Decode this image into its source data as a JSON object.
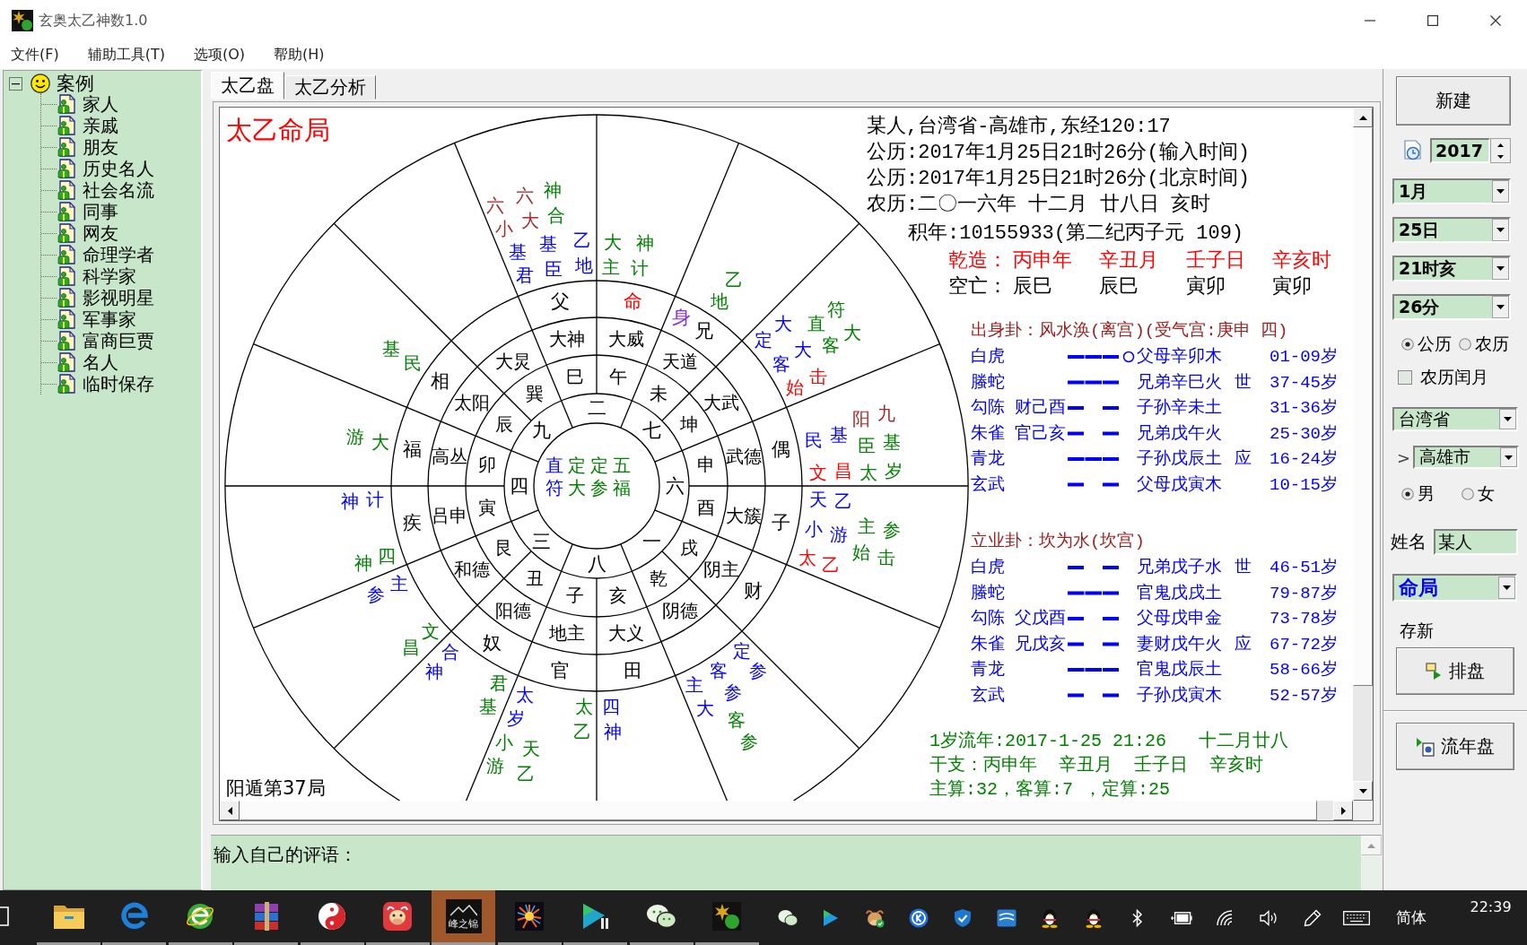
{
  "window": {
    "title": "玄奥太乙神数1.0"
  },
  "menu": [
    "文件(F)",
    "辅助工具(T)",
    "选项(O)",
    "帮助(H)"
  ],
  "tree": {
    "label": "案例",
    "expanded": true,
    "children": [
      {
        "label": "家人",
        "selected": false
      },
      {
        "label": "亲戚",
        "selected": false
      },
      {
        "label": "朋友",
        "selected": false
      },
      {
        "label": "历史名人",
        "selected": false
      },
      {
        "label": "社会名流",
        "selected": false
      },
      {
        "label": "同事",
        "selected": false
      },
      {
        "label": "网友",
        "selected": false
      },
      {
        "label": "命理学者",
        "selected": false
      },
      {
        "label": "科学家",
        "selected": false
      },
      {
        "label": "影视明星",
        "selected": false
      },
      {
        "label": "军事家",
        "selected": false
      },
      {
        "label": "富商巨贾",
        "selected": false
      },
      {
        "label": "名人",
        "selected": false
      },
      {
        "label": "临时保存",
        "selected": false
      }
    ]
  },
  "tabs": [
    {
      "label": "太乙盘",
      "selected": true
    },
    {
      "label": "太乙分析",
      "selected": false
    }
  ],
  "chart": {
    "title": "太乙命局",
    "footer": "阳遁第37局",
    "center": [
      {
        "text": "直符",
        "color": "#0000ff"
      },
      {
        "text": "定大",
        "color": "#008000"
      },
      {
        "text": "定参",
        "color": "#008000"
      },
      {
        "text": "五福",
        "color": "#008000"
      }
    ],
    "numbers": [
      "二",
      "九",
      "七",
      "四",
      "六",
      "三",
      "一",
      "八"
    ],
    "sectors": [
      {
        "branch": "巳",
        "god": "大神",
        "palaces": [
          {
            "text": "父",
            "color": "#000000"
          }
        ],
        "stars": [
          {
            "text": "六小",
            "color": "#a52a2a"
          },
          {
            "text": "六大",
            "color": "#a52a2a"
          },
          {
            "text": "神合",
            "color": "#008000"
          },
          {
            "text": "基君",
            "color": "#0000ff"
          },
          {
            "text": "基臣",
            "color": "#0000ff"
          },
          {
            "text": "乙地",
            "color": "#0000ff"
          }
        ]
      },
      {
        "branch": "午",
        "god": "大威",
        "palaces": [
          {
            "text": "命",
            "color": "#ff0000"
          }
        ],
        "stars": [
          {
            "text": "大主",
            "color": "#008000"
          },
          {
            "text": "神计",
            "color": "#008000"
          }
        ]
      },
      {
        "branch": "巽",
        "god": "大炅"
      },
      {
        "branch": "未",
        "god": "天道",
        "palaces": [
          {
            "text": "身",
            "color": "#8a2be2"
          },
          {
            "text": "兄",
            "color": "#000000"
          }
        ],
        "stars": [
          {
            "text": "乙地",
            "color": "#008000"
          }
        ]
      },
      {
        "branch": "辰",
        "god": "太阳",
        "palaces": [
          {
            "text": "相",
            "color": "#000000"
          }
        ],
        "stars": [
          {
            "text": "基民",
            "color": "#008000"
          }
        ]
      },
      {
        "branch": "坤",
        "god": "大武",
        "stars": [
          {
            "text": "大定",
            "color": "#0000ff"
          },
          {
            "text": "大客",
            "color": "#0000ff"
          },
          {
            "text": "符直",
            "color": "#008000"
          },
          {
            "text": "大客",
            "color": "#008000"
          },
          {
            "text": "始击",
            "color": "#ff0000"
          }
        ]
      },
      {
        "branch": "卯",
        "god": "高丛",
        "palaces": [
          {
            "text": "福",
            "color": "#000000"
          }
        ],
        "stars": [
          {
            "text": "游大",
            "color": "#008000"
          }
        ]
      },
      {
        "branch": "申",
        "god": "武德",
        "palaces": [
          {
            "text": "偶",
            "color": "#000000"
          }
        ],
        "stars": [
          {
            "text": "阳九",
            "color": "#a52a2a"
          },
          {
            "text": "民基",
            "color": "#0000ff"
          },
          {
            "text": "臣基",
            "color": "#008000"
          },
          {
            "text": "文昌",
            "color": "#ff0000"
          },
          {
            "text": "太岁",
            "color": "#008000"
          }
        ]
      },
      {
        "branch": "寅",
        "god": "吕申",
        "palaces": [
          {
            "text": "疾",
            "color": "#000000"
          }
        ],
        "stars": [
          {
            "text": "神计",
            "color": "#0000ff"
          },
          {
            "text": "神四",
            "color": "#008000"
          }
        ]
      },
      {
        "branch": "酉",
        "god": "大簇",
        "palaces": [
          {
            "text": "子",
            "color": "#000000"
          }
        ],
        "stars": [
          {
            "text": "天乙",
            "color": "#0000ff"
          },
          {
            "text": "小游",
            "color": "#0000ff"
          },
          {
            "text": "主参",
            "color": "#008000"
          },
          {
            "text": "太乙",
            "color": "#ff0000"
          },
          {
            "text": "始击",
            "color": "#008000"
          }
        ]
      },
      {
        "branch": "艮",
        "god": "和德",
        "stars": [
          {
            "text": "参主",
            "color": "#0000ff"
          },
          {
            "text": "文昌",
            "color": "#008000"
          }
        ]
      },
      {
        "branch": "戌",
        "god": "阴主",
        "palaces": [
          {
            "text": "财",
            "color": "#000000"
          }
        ]
      },
      {
        "branch": "丑",
        "god": "阳德",
        "palaces": [
          {
            "text": "奴",
            "color": "#000000"
          }
        ],
        "stars": [
          {
            "text": "合神",
            "color": "#0000ff"
          },
          {
            "text": "君基",
            "color": "#008000"
          }
        ]
      },
      {
        "branch": "乾",
        "god": "阴德",
        "stars": [
          {
            "text": "定参",
            "color": "#0000ff"
          },
          {
            "text": "客参",
            "color": "#0000ff"
          },
          {
            "text": "主大",
            "color": "#0000ff"
          },
          {
            "text": "客参",
            "color": "#008000"
          }
        ]
      },
      {
        "branch": "子",
        "god": "地主",
        "palaces": [
          {
            "text": "官",
            "color": "#000000"
          }
        ],
        "stars": [
          {
            "text": "太岁",
            "color": "#0000ff"
          },
          {
            "text": "太乙",
            "color": "#008000"
          },
          {
            "text": "小游",
            "color": "#008000"
          },
          {
            "text": "天乙",
            "color": "#008000"
          }
        ]
      },
      {
        "branch": "亥",
        "god": "大义",
        "palaces": [
          {
            "text": "田",
            "color": "#000000"
          }
        ],
        "stars": [
          {
            "text": "四神",
            "color": "#0000ff"
          }
        ]
      }
    ]
  },
  "info": {
    "lines": [
      "某人,台湾省-高雄市,东经120:17",
      "公历:2017年1月25日21时26分(输入时间)",
      "公历:2017年1月25日21时26分(北京时间)",
      "农历:二〇一六年 十二月 廿八日 亥时"
    ],
    "accumulated": "积年:10155933(第二纪丙子元 109)",
    "pillars": {
      "label": "乾造：",
      "values": [
        "丙申年",
        "辛丑月",
        "壬子日",
        "辛亥时"
      ]
    },
    "void": {
      "label": "空亡：",
      "values": [
        "辰巳",
        "辰巳",
        "寅卯",
        "寅卯"
      ]
    }
  },
  "gua": [
    {
      "title": "出身卦：风水涣(离宫)(受气宫:庚申 四)",
      "lines": [
        {
          "god": "白虎",
          "kind": "yang",
          "moving": true,
          "relation": "父母辛卯木",
          "age": "01-09岁"
        },
        {
          "god": "螣蛇",
          "kind": "yang",
          "moving": false,
          "relation": "兄弟辛巳火",
          "mark": "世",
          "age": "37-45岁"
        },
        {
          "god": "勾陈",
          "hidden": "财己酉",
          "kind": "yin",
          "moving": false,
          "relation": "子孙辛未土",
          "age": "31-36岁"
        },
        {
          "god": "朱雀",
          "hidden": "官己亥",
          "kind": "yin",
          "moving": false,
          "relation": "兄弟戊午火",
          "age": "25-30岁"
        },
        {
          "god": "青龙",
          "kind": "yang",
          "moving": false,
          "relation": "子孙戊辰土",
          "mark": "应",
          "age": "16-24岁"
        },
        {
          "god": "玄武",
          "kind": "yin",
          "moving": false,
          "relation": "父母戊寅木",
          "age": "10-15岁"
        }
      ]
    },
    {
      "title": "立业卦：坎为水(坎宫)",
      "lines": [
        {
          "god": "白虎",
          "kind": "yin",
          "moving": false,
          "relation": "兄弟戊子水",
          "mark": "世",
          "age": "46-51岁"
        },
        {
          "god": "螣蛇",
          "kind": "yang",
          "moving": false,
          "relation": "官鬼戊戌土",
          "age": "79-87岁"
        },
        {
          "god": "勾陈",
          "hidden": "父戊酉",
          "kind": "yin",
          "moving": false,
          "relation": "父母戊申金",
          "age": "73-78岁"
        },
        {
          "god": "朱雀",
          "hidden": "兄戊亥",
          "kind": "yin",
          "moving": false,
          "relation": "妻财戊午火",
          "mark": "应",
          "age": "67-72岁"
        },
        {
          "god": "青龙",
          "kind": "yang",
          "moving": false,
          "relation": "官鬼戊辰土",
          "age": "58-66岁"
        },
        {
          "god": "玄武",
          "kind": "yin",
          "moving": false,
          "relation": "子孙戊寅木",
          "age": "52-57岁"
        }
      ]
    }
  ],
  "annual": [
    "1岁流年:2017-1-25 21:26   十二月廿八",
    "干支：丙申年  辛丑月  壬子日  辛亥时",
    "主算:32，客算:7 ，定算:25"
  ],
  "comment": {
    "value": "输入自己的评语："
  },
  "controls": {
    "new_button": "新建",
    "year": "2017",
    "month": "1月",
    "day": "25日",
    "hour": "21时亥",
    "minute": "26分",
    "calendar": [
      {
        "label": "公历",
        "selected": true
      },
      {
        "label": "农历",
        "selected": false
      }
    ],
    "leap_month": {
      "label": "农历闰月",
      "checked": false
    },
    "province": "台湾省",
    "city_prefix": ">",
    "city": "高雄市",
    "gender": [
      {
        "label": "男",
        "selected": true
      },
      {
        "label": "女",
        "selected": false
      }
    ],
    "name": {
      "label": "姓名",
      "value": "某人"
    },
    "mode": "命局",
    "save_new": "存新",
    "arrange_button": "排盘",
    "annual_button": "流年盘"
  },
  "taskbar": {
    "apps": [
      {
        "kind": "taskview",
        "running": false,
        "selected": false
      },
      {
        "kind": "folder",
        "running": true,
        "selected": false
      },
      {
        "kind": "edge",
        "running": true,
        "selected": false
      },
      {
        "kind": "browser",
        "running": true,
        "selected": false
      },
      {
        "kind": "archive",
        "running": true,
        "selected": false
      },
      {
        "kind": "yinyang",
        "running": true,
        "selected": false
      },
      {
        "kind": "cow",
        "running": true,
        "selected": false
      },
      {
        "kind": "mountain",
        "label": "峰之锦",
        "running": true,
        "selected": true
      },
      {
        "kind": "fireworks",
        "running": true,
        "selected": false
      },
      {
        "kind": "player",
        "running": true,
        "selected": false
      },
      {
        "kind": "chat",
        "running": true,
        "selected": false
      },
      {
        "kind": "program",
        "running": true,
        "selected": false
      }
    ],
    "tray": [
      {
        "kind": "chat"
      },
      {
        "kind": "play"
      },
      {
        "kind": "cow"
      },
      {
        "kind": "k"
      },
      {
        "kind": "shield"
      },
      {
        "kind": "window"
      },
      {
        "kind": "penguin"
      },
      {
        "kind": "penguin"
      },
      {
        "kind": "bluetooth"
      },
      {
        "kind": "battery"
      },
      {
        "kind": "wifi"
      },
      {
        "kind": "volume"
      },
      {
        "kind": "pen"
      },
      {
        "kind": "keyboard"
      }
    ],
    "language": "简体",
    "time": "22:39"
  }
}
